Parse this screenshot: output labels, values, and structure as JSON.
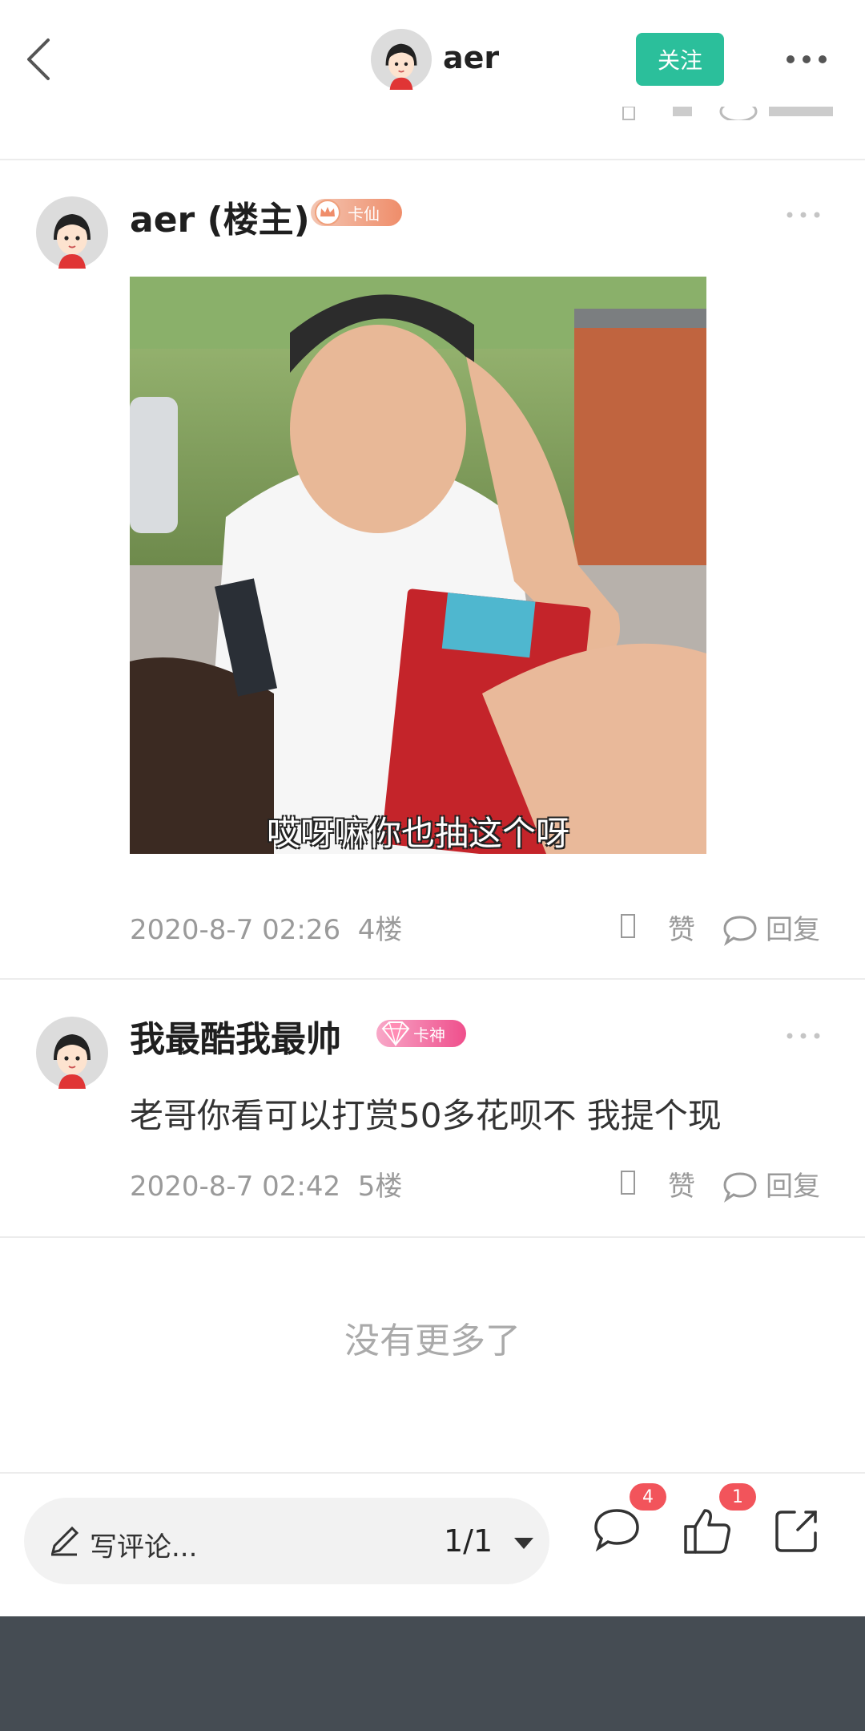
{
  "header": {
    "username": "aer",
    "follow_label": "关注",
    "back_icon": "chevron-left-icon",
    "more_icon": "more-horizontal-icon",
    "accent_color": "#2bbf9b"
  },
  "posts": [
    {
      "username": "aer (楼主)",
      "badge": "卡仙",
      "image_caption": "哎呀嘛你也抽这个呀",
      "timestamp": "2020-8-7 02:26",
      "floor": "4楼",
      "like_label": "赞",
      "reply_label": "回复"
    },
    {
      "username": "我最酷我最帅",
      "badge": "卡神",
      "text": "老哥你看可以打赏50多花呗不 我提个现",
      "timestamp": "2020-8-7 02:42",
      "floor": "5楼",
      "like_label": "赞",
      "reply_label": "回复"
    }
  ],
  "footer": {
    "no_more": "没有更多了"
  },
  "bottom_bar": {
    "write_placeholder": "写评论...",
    "page_indicator": "1/1",
    "comment_count": "4",
    "like_count": "1",
    "badge_color": "#f2545b"
  }
}
